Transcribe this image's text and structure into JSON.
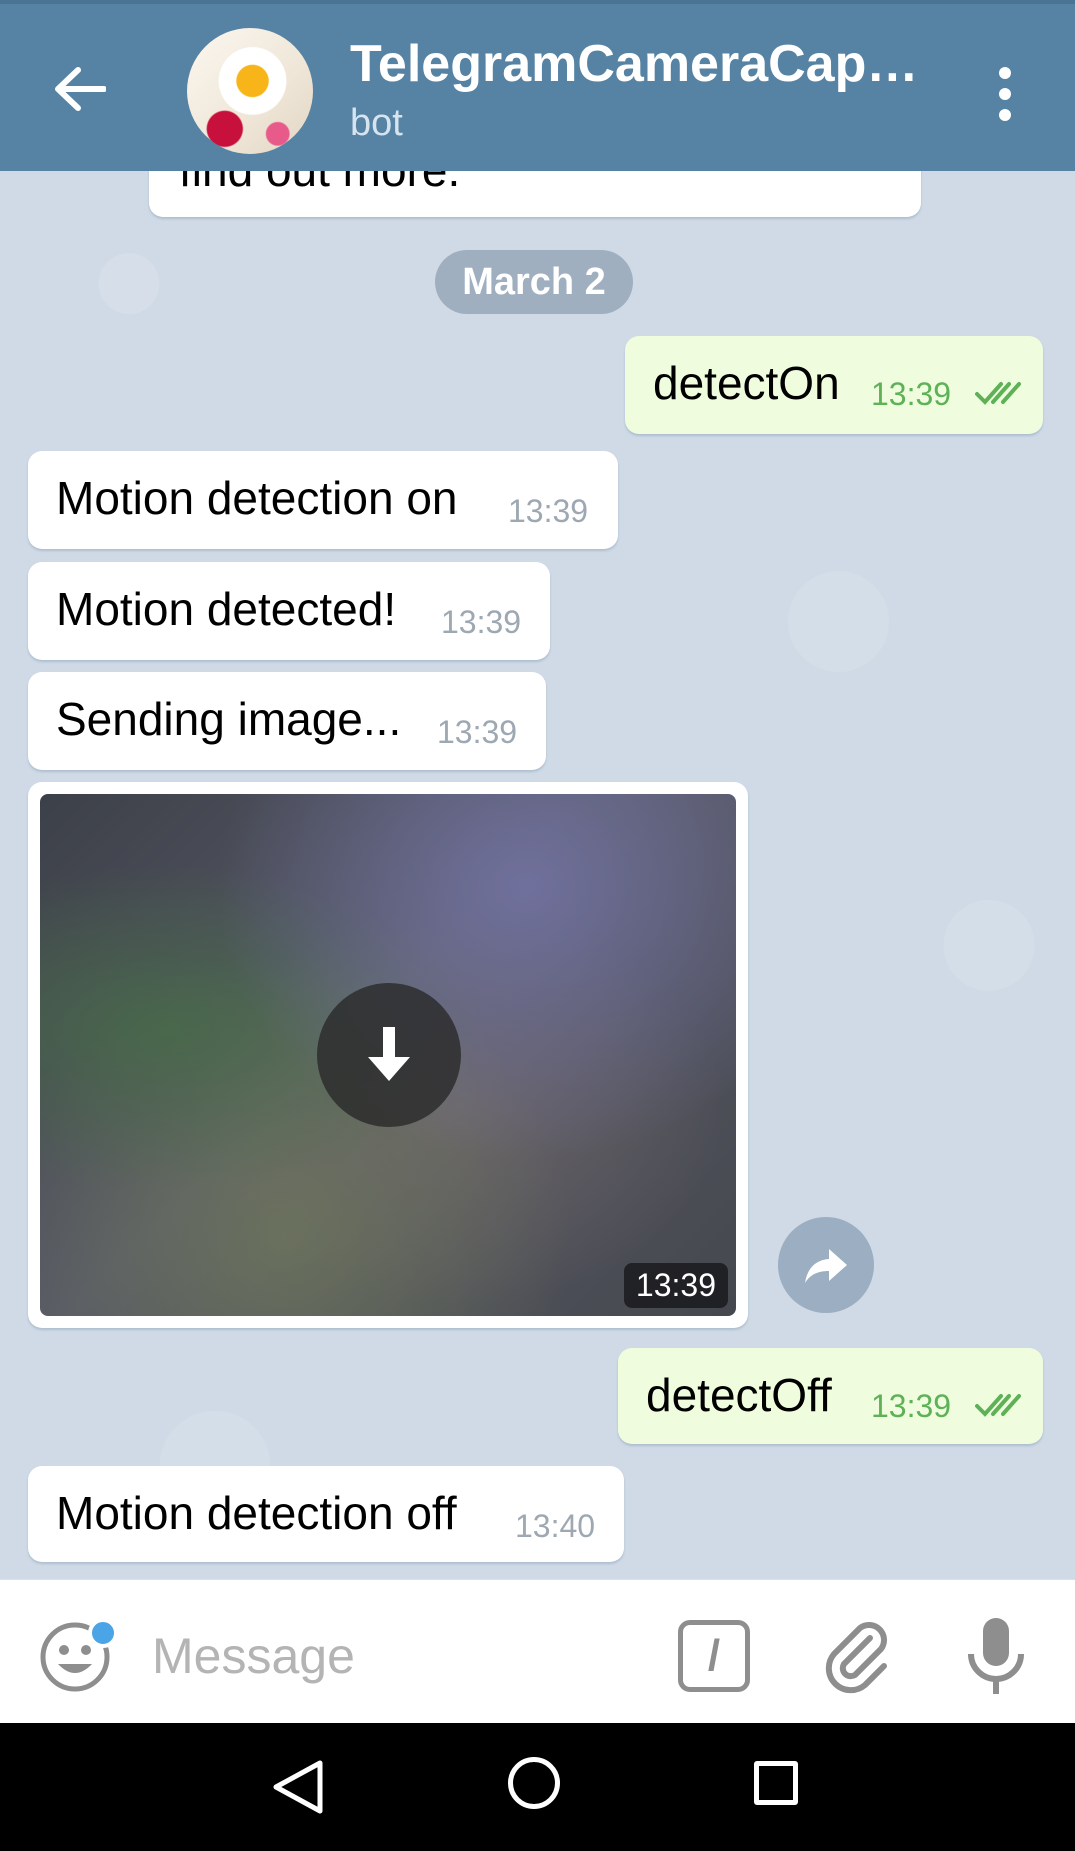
{
  "header": {
    "title": "TelegramCameraCapt…",
    "subtitle": "bot"
  },
  "chat": {
    "partial_message": "find out more.",
    "date_separator": "March 2",
    "messages": [
      {
        "direction": "out",
        "text": "detectOn",
        "time": "13:39",
        "status": "read"
      },
      {
        "direction": "in",
        "text": "Motion detection on",
        "time": "13:39"
      },
      {
        "direction": "in",
        "text": "Motion detected!",
        "time": "13:39"
      },
      {
        "direction": "in",
        "text": "Sending image...",
        "time": "13:39"
      },
      {
        "direction": "in",
        "type": "photo",
        "time": "13:39"
      },
      {
        "direction": "out",
        "text": "detectOff",
        "time": "13:39",
        "status": "read"
      },
      {
        "direction": "in",
        "text": "Motion detection off",
        "time": "13:40"
      }
    ]
  },
  "input": {
    "placeholder": "Message",
    "command_icon_glyph": "/"
  },
  "colors": {
    "header": "#5682a3",
    "chat_background": "#cfdae6",
    "outgoing_bubble": "#effdde",
    "incoming_bubble": "#ffffff",
    "read_ticks": "#5fb158",
    "unread_dot": "#4ba4e6"
  },
  "icons": {
    "header": [
      "back-arrow-icon",
      "more-vertical-icon"
    ],
    "photo": [
      "download-icon",
      "share-icon"
    ],
    "input": [
      "emoji-icon",
      "command-icon",
      "attach-icon",
      "microphone-icon"
    ],
    "navbar": [
      "nav-back-icon",
      "nav-home-icon",
      "nav-recents-icon"
    ]
  }
}
